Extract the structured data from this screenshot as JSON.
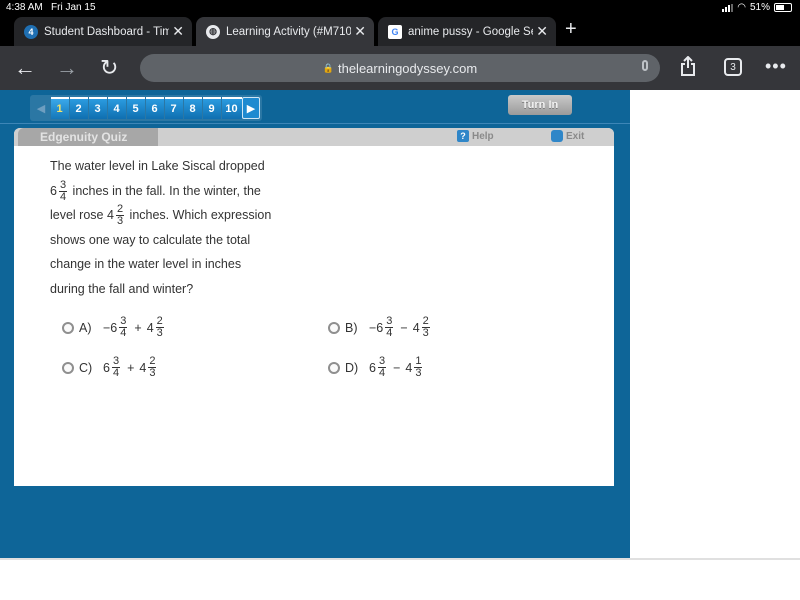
{
  "status_bar": {
    "time": "4:38 AM",
    "date": "Fri Jan 15",
    "battery": "51%"
  },
  "tabs": [
    {
      "title": "Student Dashboard - Timeline",
      "favicon": "edgenuity-icon",
      "favicon_text": "4",
      "active": false
    },
    {
      "title": "Learning Activity (#M710",
      "favicon": "globe-icon",
      "favicon_text": "🌐",
      "active": true
    },
    {
      "title": "anime pussy - Google Search",
      "favicon": "google-icon",
      "favicon_text": "G",
      "active": false
    }
  ],
  "toolbar": {
    "back": "←",
    "forward": "→",
    "reload": "↻",
    "url": "thelearningodyssey.com",
    "tab_count": "3",
    "more": "•••"
  },
  "quiz_nav": {
    "questions": [
      "1",
      "2",
      "3",
      "4",
      "5",
      "6",
      "7",
      "8",
      "9",
      "10"
    ],
    "current": "1",
    "prev": "◀",
    "next": "▶",
    "turn_in_label": "Turn In"
  },
  "panel": {
    "title": "Edgenuity Quiz",
    "help_label": "Help",
    "help_glyph": "?",
    "exit_label": "Exit"
  },
  "question": {
    "line1": "The water level in Lake Siscal dropped",
    "line2_pre": "6",
    "line2_num": "3",
    "line2_den": "4",
    "line2_post": " inches in the fall. In the winter, the",
    "line3_pre": "level rose 4",
    "line3_num": "2",
    "line3_den": "3",
    "line3_post": " inches. Which expression",
    "line4": "shows one way to calculate the total",
    "line5": "change in the water level in inches",
    "line6": "during the fall and winter?"
  },
  "choices": [
    {
      "label": "A)",
      "a_whole": "−6",
      "a_num": "3",
      "a_den": "4",
      "op": "+",
      "b_whole": "4",
      "b_num": "2",
      "b_den": "3"
    },
    {
      "label": "B)",
      "a_whole": "−6",
      "a_num": "3",
      "a_den": "4",
      "op": "−",
      "b_whole": "4",
      "b_num": "2",
      "b_den": "3"
    },
    {
      "label": "C)",
      "a_whole": "6",
      "a_num": "3",
      "a_den": "4",
      "op": "+",
      "b_whole": "4",
      "b_num": "2",
      "b_den": "3"
    },
    {
      "label": "D)",
      "a_whole": "6",
      "a_num": "3",
      "a_den": "4",
      "op": "−",
      "b_whole": "4",
      "b_num": "1",
      "b_den": "3"
    }
  ]
}
